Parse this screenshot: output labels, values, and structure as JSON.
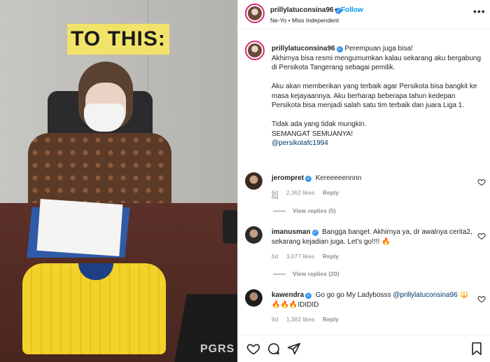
{
  "photo": {
    "banner_text": "TO THIS:",
    "box_text": "PGRS"
  },
  "header": {
    "username": "prillylatuconsina96",
    "dot": "•",
    "follow_label": "Follow",
    "song": "Ne-Yo • Miss Independent",
    "more_icon": "more-horizontal-icon"
  },
  "caption": {
    "username": "prillylatuconsina96",
    "first_line": "Perempuan juga bisa!",
    "para1": "Akhirnya bisa resmi mengumumkan kalau sekarang aku bergabung di Persikota Tangerang sebagai pemilik.",
    "para2": "Aku akan memberikan yang terbaik agar Persikota bisa bangkit ke masa kejayaannya. Aku berharap beberapa tahun kedepan Persikota bisa menjadi salah satu tim terbaik dan juara Liga 1.",
    "para3a": "Tidak ada yang tidak mungkin.",
    "para3b": "SEMANGAT SEMUANYA!",
    "mention": "@persikotafc1994",
    "time": "6d"
  },
  "comments": [
    {
      "username": "jerompret",
      "text": "Kereeeeennnn",
      "time": "6d",
      "likes": "2,362 likes",
      "reply": "Reply",
      "view_replies": "View replies (5)"
    },
    {
      "username": "imanusman",
      "text": "Bangga banget. Akhirnya ya, dr awalnya cerita2, sekarang kejadian juga. Let's go!!!! 🔥",
      "time": "6d",
      "likes": "3,077 likes",
      "reply": "Reply",
      "view_replies": "View replies (20)"
    },
    {
      "username": "kawendra",
      "text_pre": "Go go go My Ladybosss ",
      "mention": "@prillylatuconsina96",
      "text_post": " 🔱🔥🔥🔥IDIDID",
      "time": "6d",
      "likes": "1,382 likes",
      "reply": "Reply"
    }
  ],
  "actions": {
    "like_icon": "heart-icon",
    "comment_icon": "comment-icon",
    "share_icon": "share-icon",
    "save_icon": "bookmark-icon"
  },
  "colors": {
    "follow_blue": "#0095f6",
    "verified_blue": "#3897f0",
    "muted_gray": "#8e8e8e",
    "mention_blue": "#00376b",
    "banner_yellow": "#f1e36a"
  }
}
